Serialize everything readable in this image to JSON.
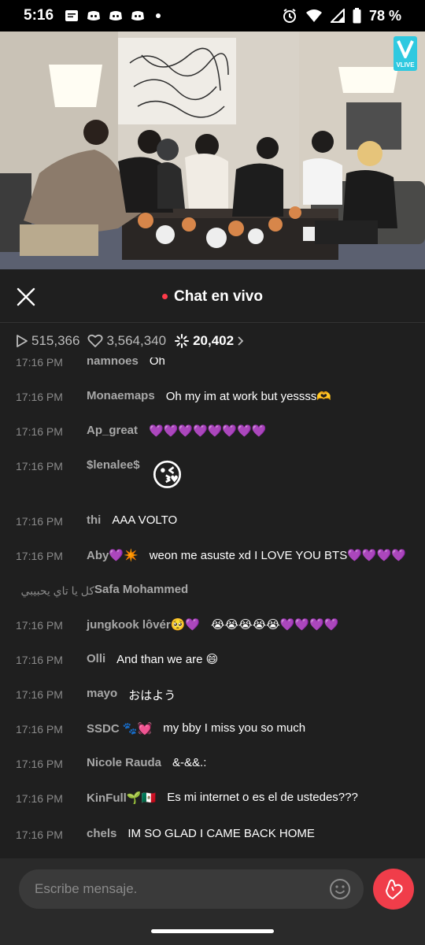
{
  "status_bar": {
    "time": "5:16",
    "battery": "78 %"
  },
  "video": {
    "badge": "VLIVE"
  },
  "chat_header": {
    "title": "Chat en vivo"
  },
  "stats": {
    "plays": "515,366",
    "likes": "3,564,340",
    "viewers": "20,402"
  },
  "messages": [
    {
      "time": "17:16 PM",
      "user": "namnoes",
      "text": "Oh"
    },
    {
      "time": "17:16 PM",
      "user": "Monaemaps",
      "text": "Oh my im at work but yessss🫶"
    },
    {
      "time": "17:16 PM",
      "user": "Ap_great",
      "text": "💜💜💜💜💜💜💜💜"
    },
    {
      "time": "17:16 PM",
      "user": "$lenalee$",
      "text": "😘"
    },
    {
      "time": "17:16 PM",
      "user": "thi",
      "text": "AAA VOLTO"
    },
    {
      "time": "17:16 PM",
      "user": "Aby💜✴️",
      "text": "weon me asuste xd I LOVE YOU BTS💜💜💜💜"
    },
    {
      "time": "17:16 PM",
      "user": "Safa Mohammed",
      "text": "كل يا تاي يحبيبي"
    },
    {
      "time": "17:16 PM",
      "user": "jungkook lôvér🥺💜",
      "text": "😭😭😭😭😭💜💜💜💜"
    },
    {
      "time": "17:16 PM",
      "user": "Olli",
      "text": "And than we are 😄"
    },
    {
      "time": "17:16 PM",
      "user": "mayo",
      "text": "おはよう"
    },
    {
      "time": "17:16 PM",
      "user": "SSDC 🐾💓",
      "text": "my bby I miss you so much"
    },
    {
      "time": "17:16 PM",
      "user": "Nicole Rauda",
      "text": "&-&&.:"
    },
    {
      "time": "17:16 PM",
      "user": "KinFull🌱🇲🇽",
      "text": "Es mi internet o es el de ustedes???"
    },
    {
      "time": "17:16 PM",
      "user": "chels",
      "text": "IM SO GLAD I CAME BACK HOME"
    }
  ],
  "input": {
    "placeholder": "Escribe mensaje."
  },
  "colors": {
    "accent": "#f03d4a",
    "live_dot": "#ff3b4a",
    "background": "#1f1f1f"
  }
}
